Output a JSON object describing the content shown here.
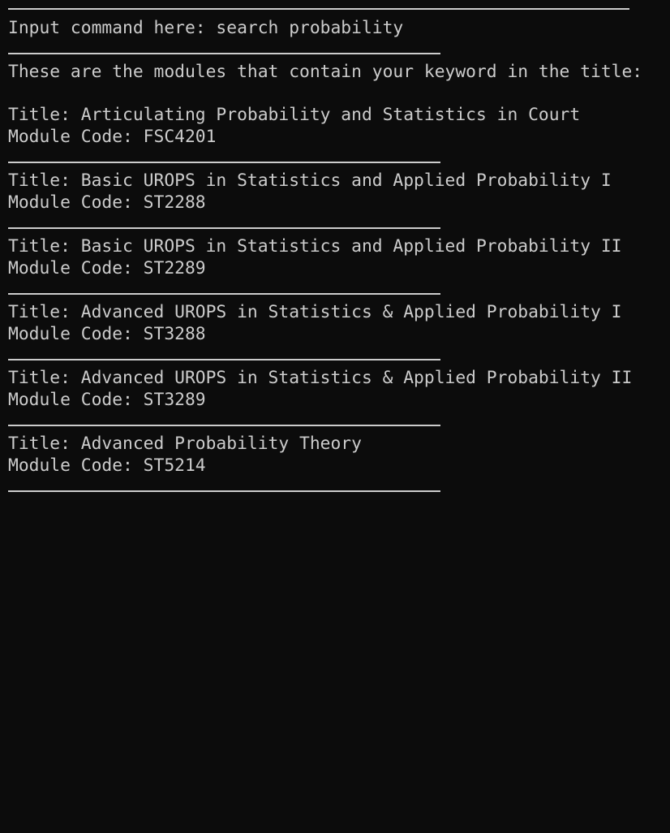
{
  "terminal": {
    "prompt": "Input command here: search probability",
    "result_header": "These are the modules that contain your keyword in the title:",
    "results": [
      {
        "title": "Title: Articulating Probability and Statistics in Court",
        "code": "Module Code: FSC4201"
      },
      {
        "title": "Title: Basic UROPS in Statistics and Applied Probability I",
        "code": "Module Code: ST2288"
      },
      {
        "title": "Title: Basic UROPS in Statistics and Applied Probability II",
        "code": "Module Code: ST2289"
      },
      {
        "title": "Title: Advanced UROPS in Statistics & Applied Probability I",
        "code": "Module Code: ST3288"
      },
      {
        "title": "Title: Advanced UROPS in Statistics & Applied Probability II",
        "code": "Module Code: ST3289"
      },
      {
        "title": "Title: Advanced Probability Theory",
        "code": "Module Code: ST5214"
      }
    ]
  },
  "colors": {
    "background": "#0c0c0c",
    "text": "#cccccc"
  }
}
